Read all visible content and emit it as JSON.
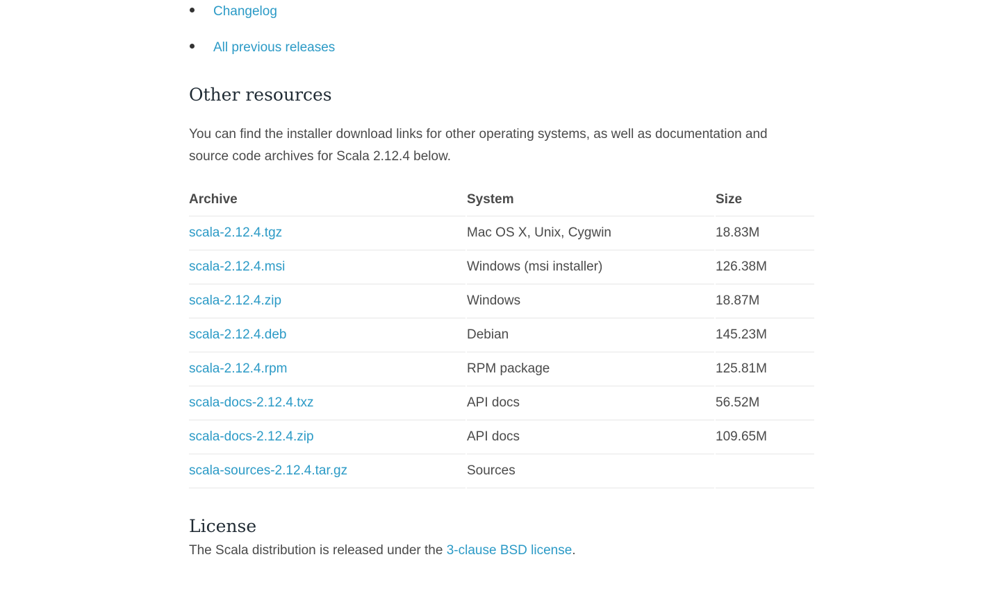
{
  "top_links": [
    {
      "label": "Changelog"
    },
    {
      "label": "All previous releases"
    }
  ],
  "resources": {
    "title": "Other resources",
    "description": "You can find the installer download links for other operating systems, as well as documentation and source code archives for Scala 2.12.4 below."
  },
  "archives_table": {
    "headers": {
      "archive": "Archive",
      "system": "System",
      "size": "Size"
    },
    "rows": [
      {
        "archive": "scala-2.12.4.tgz",
        "system": "Mac OS X, Unix, Cygwin",
        "size": "18.83M"
      },
      {
        "archive": "scala-2.12.4.msi",
        "system": "Windows (msi installer)",
        "size": "126.38M"
      },
      {
        "archive": "scala-2.12.4.zip",
        "system": "Windows",
        "size": "18.87M"
      },
      {
        "archive": "scala-2.12.4.deb",
        "system": "Debian",
        "size": "145.23M"
      },
      {
        "archive": "scala-2.12.4.rpm",
        "system": "RPM package",
        "size": "125.81M"
      },
      {
        "archive": "scala-docs-2.12.4.txz",
        "system": "API docs",
        "size": "56.52M"
      },
      {
        "archive": "scala-docs-2.12.4.zip",
        "system": "API docs",
        "size": "109.65M"
      },
      {
        "archive": "scala-sources-2.12.4.tar.gz",
        "system": "Sources",
        "size": ""
      }
    ]
  },
  "license": {
    "title": "License",
    "text_before": "The Scala distribution is released under the ",
    "link_label": "3-clause BSD license",
    "text_after": "."
  },
  "colors": {
    "link": "#2b9ac6",
    "text": "#4a4a4a",
    "heading": "#1f2a33",
    "row_border": "#e6e6e6"
  }
}
